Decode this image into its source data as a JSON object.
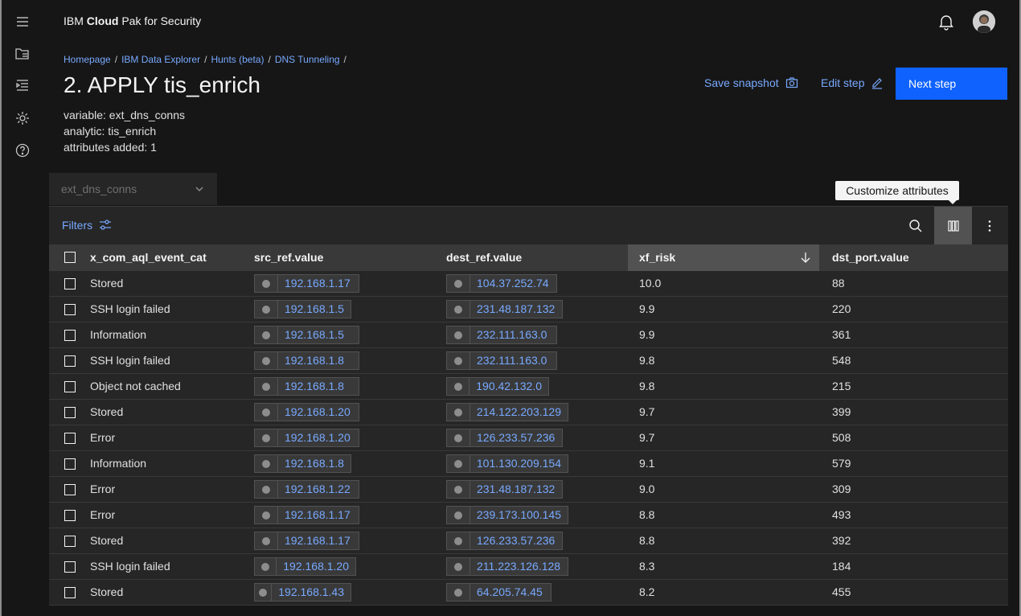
{
  "brand": {
    "prefix": "IBM ",
    "bold": "Cloud",
    "suffix": " Pak for Security"
  },
  "breadcrumb": [
    "Homepage",
    "IBM Data Explorer",
    "Hunts (beta)",
    "DNS Tunneling"
  ],
  "title": "2. APPLY tis_enrich",
  "meta": [
    "variable: ext_dns_conns",
    "analytic: tis_enrich",
    "attributes added: 1"
  ],
  "actions": {
    "save": "Save snapshot",
    "edit": "Edit step",
    "next": "Next step"
  },
  "dropdown": {
    "value": "ext_dns_conns"
  },
  "tooltip": "Customize attributes",
  "toolbar": {
    "filters": "Filters"
  },
  "columns": [
    "x_com_aql_event_cat",
    "src_ref.value",
    "dest_ref.value",
    "xf_risk",
    "dst_port.value"
  ],
  "rows": [
    {
      "cat": "Stored",
      "src": "192.168.1.17",
      "dest": "104.37.252.74",
      "risk": "10.0",
      "port": "88"
    },
    {
      "cat": "SSH login failed",
      "src": "192.168.1.5",
      "dest": "231.48.187.132",
      "risk": "9.9",
      "port": "220"
    },
    {
      "cat": "Information",
      "src": "192.168.1.5",
      "dest": "232.111.163.0",
      "risk": "9.9",
      "port": "361"
    },
    {
      "cat": "SSH login failed",
      "src": "192.168.1.8",
      "dest": "232.111.163.0",
      "risk": "9.8",
      "port": "548"
    },
    {
      "cat": "Object not cached",
      "src": "192.168.1.8",
      "dest": "190.42.132.0",
      "risk": "9.8",
      "port": "215"
    },
    {
      "cat": "Stored",
      "src": "192.168.1.20",
      "dest": "214.122.203.129",
      "risk": "9.7",
      "port": "399"
    },
    {
      "cat": "Error",
      "src": "192.168.1.20",
      "dest": "126.233.57.236",
      "risk": "9.7",
      "port": "508"
    },
    {
      "cat": "Information",
      "src": "192.168.1.8",
      "dest": "101.130.209.154",
      "risk": "9.1",
      "port": "579"
    },
    {
      "cat": "Error",
      "src": "192.168.1.22",
      "dest": "231.48.187.132",
      "risk": "9.0",
      "port": "309"
    },
    {
      "cat": "Error",
      "src": "192.168.1.17",
      "dest": "239.173.100.145",
      "risk": "8.8",
      "port": "493"
    },
    {
      "cat": "Stored",
      "src": "192.168.1.17",
      "dest": "126.233.57.236",
      "risk": "8.8",
      "port": "392"
    },
    {
      "cat": "SSH login failed",
      "src": "192.168.1.20",
      "dest": "211.223.126.128",
      "risk": "8.3",
      "port": "184"
    },
    {
      "cat": "Stored",
      "src": "192.168.1.43",
      "dest": "64.205.74.45",
      "risk": "8.2",
      "port": "455"
    }
  ]
}
